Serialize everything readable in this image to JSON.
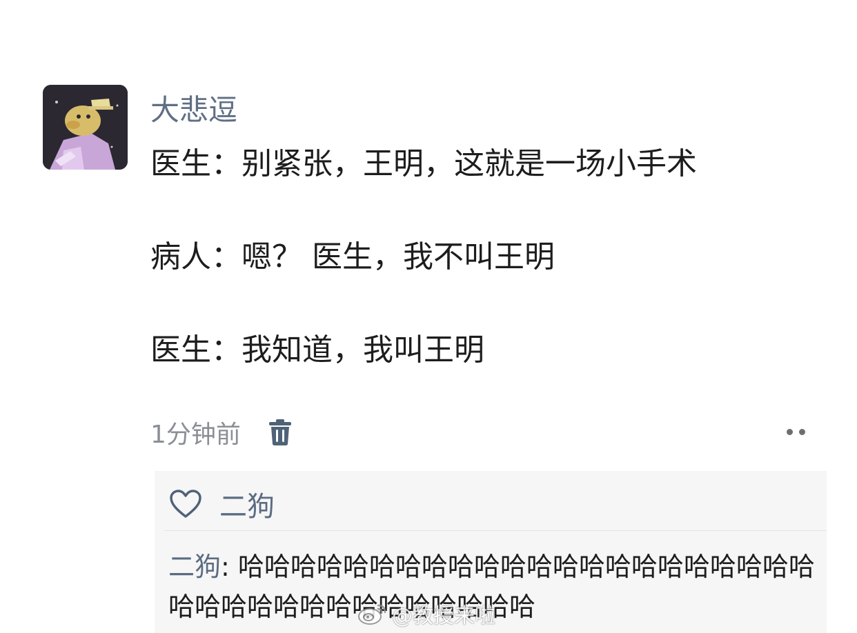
{
  "post": {
    "author": "大悲逗",
    "lines": [
      "医生：别紧张，王明，这就是一场小手术",
      "病人：嗯？ 医生，我不叫王明",
      "医生：我知道，我叫王明"
    ],
    "timestamp": "1分钟前"
  },
  "reply": {
    "liked_by": "二狗",
    "comment_author": "二狗",
    "comment_separator": ": ",
    "comment_text": "哈哈哈哈哈哈哈哈哈哈哈哈哈哈哈哈哈哈哈哈哈哈哈哈哈哈哈哈哈哈哈哈哈哈哈哈"
  },
  "watermark": {
    "text": "@教授来啦"
  },
  "colors": {
    "name_blue": "#5f6f84",
    "meta_gray": "#8a8f96",
    "reply_bg": "#f6f6f6"
  },
  "icons": {
    "avatar": "cartoon-duck-avatar",
    "trash": "trash-icon",
    "more": "more-dots-icon",
    "heart": "heart-outline-icon",
    "weibo": "weibo-logo-icon"
  }
}
